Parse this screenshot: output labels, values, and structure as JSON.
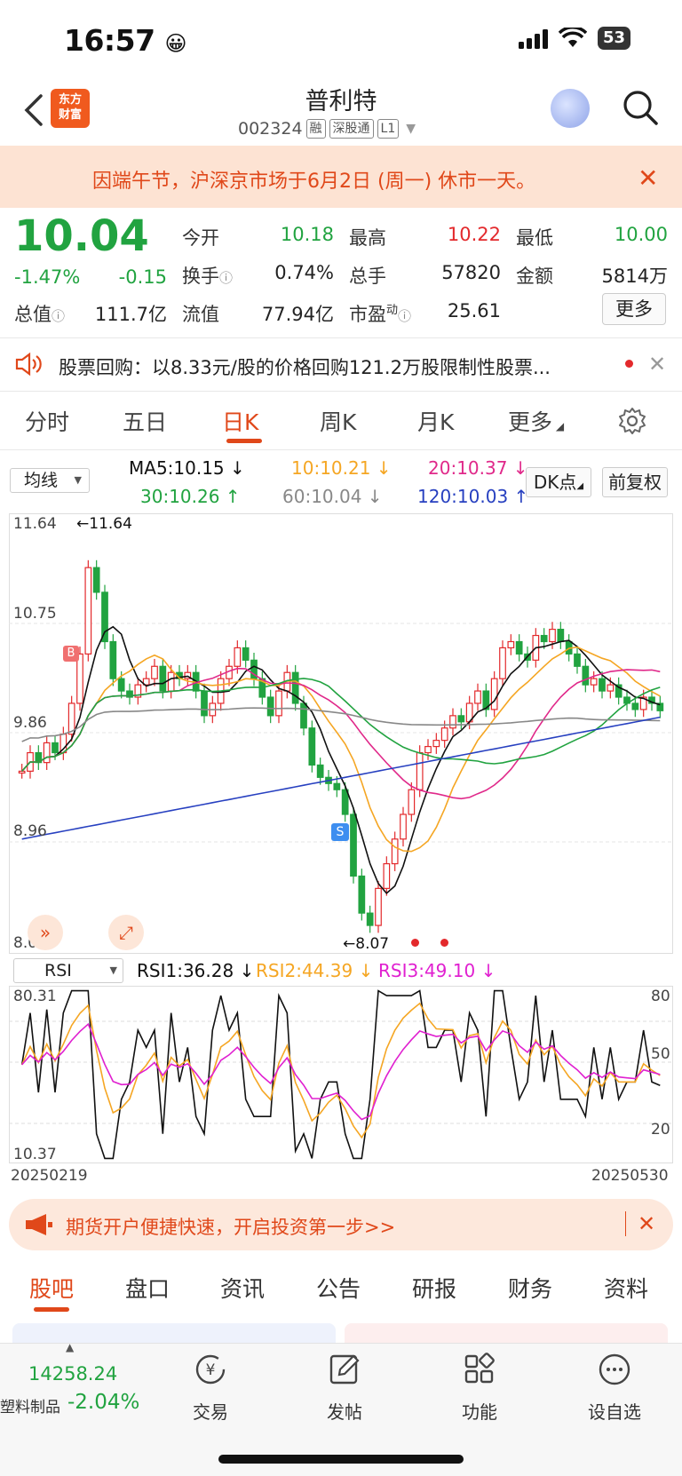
{
  "status_bar": {
    "time": "16:57",
    "emoji": "😀",
    "battery": "53"
  },
  "header": {
    "logo_line1": "东方",
    "logo_line2": "财富",
    "title": "普利特",
    "code": "002324",
    "tags": [
      "融",
      "深股通",
      "L1"
    ]
  },
  "notice": {
    "text": "因端午节，沪深京市场于6月2日 (周一) 休市一天。"
  },
  "quote": {
    "price": "10.04",
    "change_pct": "-1.47%",
    "change": "-0.15",
    "market_cap_label": "总值",
    "market_cap": "111.7亿",
    "cells": [
      {
        "label": "今开",
        "value": "10.18",
        "color": "green"
      },
      {
        "label": "最高",
        "value": "10.22",
        "color": "red"
      },
      {
        "label": "最低",
        "value": "10.00",
        "color": "green"
      },
      {
        "label": "换手",
        "value": "0.74%",
        "color": "black"
      },
      {
        "label": "总手",
        "value": "57820",
        "color": "black"
      },
      {
        "label": "金额",
        "value": "5814万",
        "color": "black"
      },
      {
        "label": "流值",
        "value": "77.94亿",
        "color": "black"
      },
      {
        "label": "市盈",
        "label_sup": "动",
        "value": "25.61",
        "color": "black"
      }
    ],
    "more_button": "更多"
  },
  "buyback": {
    "text": "股票回购：以8.33元/股的价格回购121.2万股限制性股票..."
  },
  "k_tabs": [
    "分时",
    "五日",
    "日K",
    "周K",
    "月K",
    "更多"
  ],
  "ma_row": {
    "selector": "均线",
    "ma5": "MA5:10.15",
    "ma10": "10:10.21",
    "ma20": "20:10.37",
    "ma30": "30:10.26",
    "ma60": "60:10.04",
    "ma120": "120:10.03",
    "dk_button": "DK点",
    "fq_button": "前复权"
  },
  "kline_axis": {
    "top": "11.64",
    "upper_mid": "10.75",
    "mid": "9.86",
    "lower_mid": "8.96",
    "bottom": "8.07",
    "max_marker": "11.64",
    "min_marker": "8.07",
    "buy_marker": "B",
    "sell_marker": "S"
  },
  "rsi_row": {
    "selector": "RSI",
    "rsi1": "RSI1:36.28",
    "rsi2": "RSI2:44.39",
    "rsi3": "RSI3:49.10"
  },
  "rsi_axis": {
    "top_left": "80.31",
    "bottom_left": "10.37",
    "r80": "80",
    "r50": "50",
    "r20": "20"
  },
  "dates": {
    "start": "20250219",
    "end": "20250530"
  },
  "promo": {
    "text": "期货开户便捷快速，开启投资第一步>>"
  },
  "bottom_tabs": [
    "股吧",
    "盘口",
    "资讯",
    "公告",
    "研报",
    "财务",
    "资料"
  ],
  "dock": {
    "index_value": "14258.24",
    "index_name": "塑料制品",
    "index_change": "-2.04%",
    "items": [
      "交易",
      "发帖",
      "功能",
      "设自选"
    ]
  },
  "colors": {
    "accent": "#e0481a",
    "up": "#e3292c",
    "down": "#21a340",
    "ma5": "#111111",
    "ma10": "#f5a623",
    "ma20": "#e0298a",
    "ma30": "#21a340",
    "ma60": "#888888",
    "ma120": "#2740c0"
  }
}
